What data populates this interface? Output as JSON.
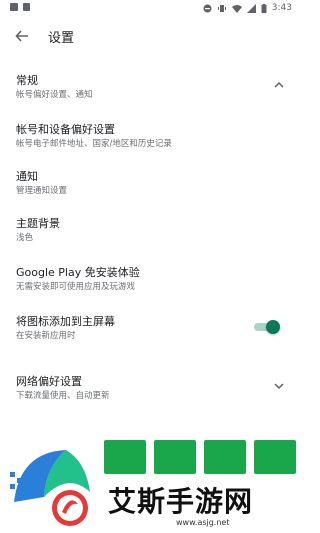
{
  "status_bar": {
    "time": "3:43"
  },
  "header": {
    "title": "设置"
  },
  "settings": [
    {
      "title": "常规",
      "subtitle": "帐号偏好设置、通知",
      "control": "chevron-up"
    },
    {
      "title": "帐号和设备偏好设置",
      "subtitle": "帐号电子邮件地址、国家/地区和历史记录",
      "control": "none"
    },
    {
      "title": "通知",
      "subtitle": "管理通知设置",
      "control": "none"
    },
    {
      "title": "主题背景",
      "subtitle": "浅色",
      "control": "none"
    },
    {
      "title": "Google Play 免安装体验",
      "subtitle": "无需安装即可使用应用及玩游戏",
      "control": "none"
    },
    {
      "title": "将图标添加到主屏幕",
      "subtitle": "在安装新应用时",
      "control": "toggle",
      "toggle_on": true
    },
    {
      "title": "网络偏好设置",
      "subtitle": "下载流量使用、自动更新",
      "control": "chevron-down"
    }
  ],
  "watermark": {
    "site_name": "艾斯手游网",
    "site_url": "www.asjg.net"
  },
  "colors": {
    "accent": "#0b7a5b",
    "toggle_track": "#a6d6c8",
    "banner_green": "#1aa64a"
  }
}
